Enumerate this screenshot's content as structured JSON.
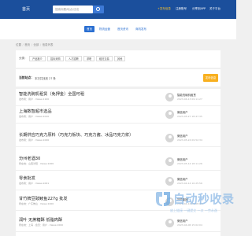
{
  "header": {
    "logo": "首页",
    "search_placeholder": "搜索标题/地点/店名",
    "links": [
      {
        "label": "+发布信息",
        "active": true
      },
      {
        "label": "注册账号",
        "active": false
      },
      {
        "label": "分享到APP",
        "active": false
      },
      {
        "label": "关于平台",
        "active": false
      }
    ]
  },
  "tabs": [
    {
      "label": "首页",
      "active": true
    },
    {
      "label": "物流运营",
      "active": false
    },
    {
      "label": "首页资讯",
      "active": false
    },
    {
      "label": "商机发布",
      "active": false
    }
  ],
  "breadcrumb": [
    "位置",
    "首页",
    "全部",
    "信息列表"
  ],
  "filter": {
    "label": "分类：",
    "chips": [
      "产品推介",
      "招标采购",
      "人才招聘",
      "求职",
      "租赁交易",
      "其他"
    ]
  },
  "result": {
    "label": "当前站点：",
    "text": "本次共找到 27 条",
    "post_button": "发布信息"
  },
  "items": [
    {
      "title": "智能洗碗机租赁（免押金）全国可租",
      "meta": "发布者：用户 · Views:1100",
      "user": "智能洗碗机租赁",
      "date": "2023-06-13 09:11:27"
    },
    {
      "title": "上海数智超市选品",
      "meta": "发布者：用户 · Views:1010",
      "user": "微信用户",
      "date": "2023-05-27 18:47:35"
    },
    {
      "title": "长期供应巧克力原料（巧克力板块、巧克力酱、冰品巧克力浆）",
      "meta": "发布者：用户 · Views:1006",
      "user": "微信用户",
      "date": "2023-05-24 09:52:34"
    },
    {
      "title": "汾州老酒30",
      "meta": "所在地：山西汾阳 · Views:1000",
      "user": "微信用户",
      "date": "2023-05-14 18:11:26"
    },
    {
      "title": "零食批发",
      "meta": "发布者：用户 · Views:1001",
      "user": "微信用户",
      "date": "2023-04-14 10:25:56"
    },
    {
      "title": "甘竹牌豆豉鲮鱼227g 批发",
      "meta": "所在地：广东佛山 · Views:1000",
      "user": "甘竹集团",
      "date": "2023-04-12 09:58:05"
    },
    {
      "title": "润叶 无蔗糖酥 低脂肉酥",
      "meta": "所在地：上海 · 会员：用户 · Views:1000",
      "user": "微信用户",
      "date": "2023-04-06 15:02:04"
    }
  ],
  "watermark": {
    "title": "自动秒收录",
    "subtitle": "放上链接 一键提交 一次 一劳永逸"
  }
}
